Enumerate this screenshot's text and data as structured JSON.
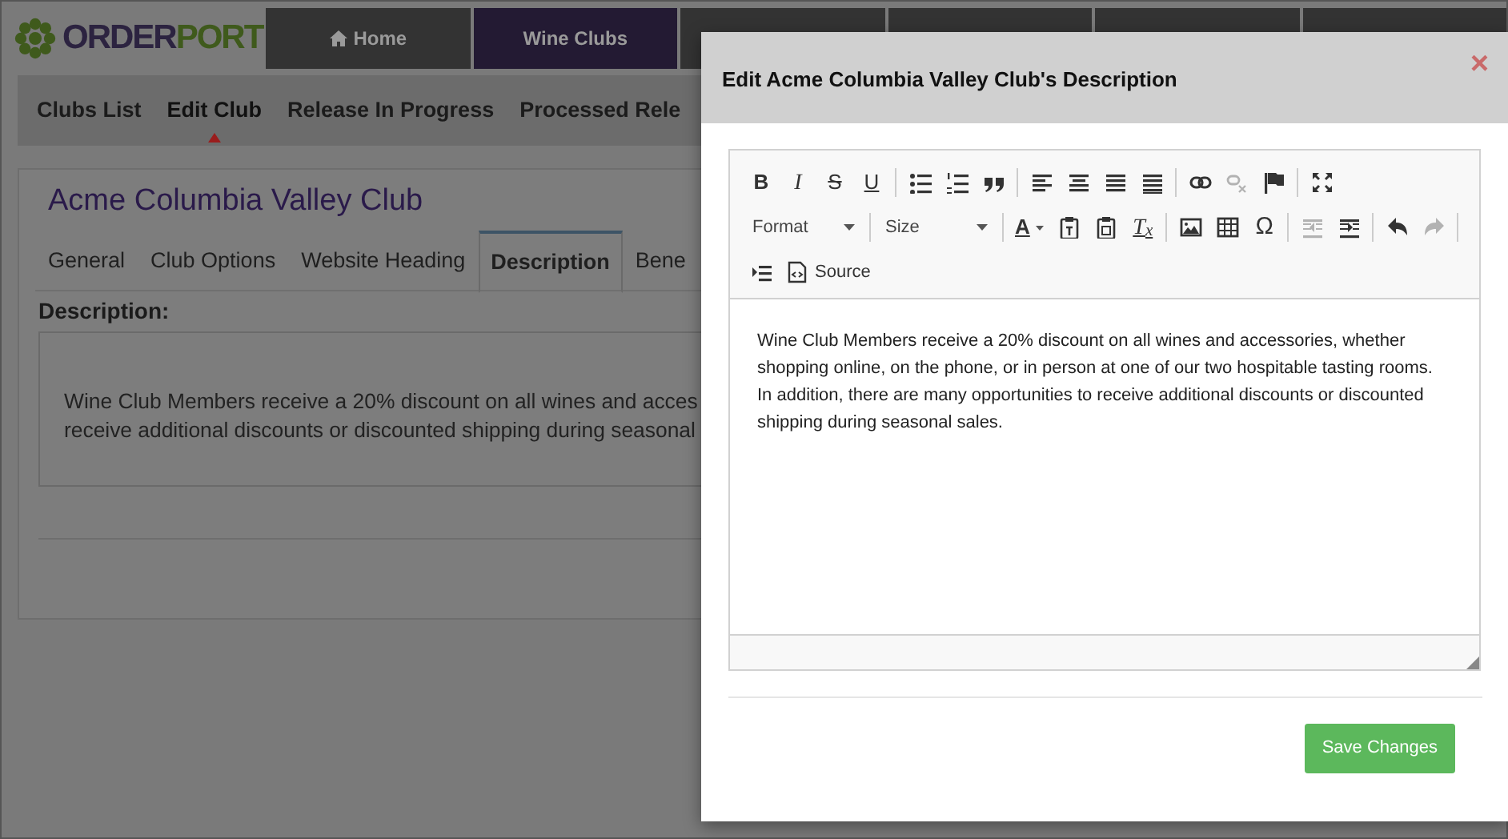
{
  "logo": {
    "first": "ORDER",
    "second": "PORT"
  },
  "top_nav": [
    {
      "kind": "icon_label",
      "label": "Home",
      "selected": false
    },
    {
      "kind": "label",
      "label": "Wine Clubs",
      "selected": true
    },
    {
      "kind": "blank",
      "selected": false
    },
    {
      "kind": "blank",
      "selected": false
    },
    {
      "kind": "blank",
      "selected": false
    },
    {
      "kind": "blank",
      "selected": false
    }
  ],
  "sub_nav": [
    {
      "label": "Clubs List",
      "selected": false
    },
    {
      "label": "Edit Club",
      "selected": true
    },
    {
      "label": "Release In Progress",
      "selected": false
    },
    {
      "label": "Processed Rele",
      "selected": false
    }
  ],
  "club_title": "Acme Columbia Valley Club",
  "tabs": [
    {
      "label": "General",
      "selected": false
    },
    {
      "label": "Club Options",
      "selected": false
    },
    {
      "label": "Website Heading",
      "selected": false
    },
    {
      "label": "Description",
      "selected": true
    },
    {
      "label": "Bene",
      "selected": false
    }
  ],
  "description_label": "Description:",
  "description_lines": [
    "Wine Club Members receive a 20% discount on all wines and acces",
    "receive additional discounts or discounted shipping during seasonal"
  ],
  "modal": {
    "title": "Edit Acme Columbia Valley Club's Description",
    "close_label": "×",
    "toolbar_rows": [
      [
        {
          "kind": "bold",
          "label": "B"
        },
        {
          "kind": "italic",
          "label": "I"
        },
        {
          "kind": "strike",
          "label": "S"
        },
        {
          "kind": "underline",
          "label": "U"
        },
        {
          "kind": "separator"
        },
        {
          "kind": "icon",
          "disabled": false
        },
        {
          "kind": "icon",
          "disabled": false
        },
        {
          "kind": "icon",
          "disabled": false
        },
        {
          "kind": "separator"
        },
        {
          "kind": "icon",
          "disabled": false
        },
        {
          "kind": "icon",
          "disabled": false
        },
        {
          "kind": "icon",
          "disabled": false
        },
        {
          "kind": "icon",
          "disabled": false
        },
        {
          "kind": "separator"
        },
        {
          "kind": "icon",
          "disabled": false
        },
        {
          "kind": "icon",
          "disabled": true
        },
        {
          "kind": "icon",
          "disabled": false
        },
        {
          "kind": "separator"
        },
        {
          "kind": "icon",
          "disabled": false
        }
      ],
      [
        {
          "kind": "dropdown",
          "label": "Format"
        },
        {
          "kind": "separator"
        },
        {
          "kind": "dropdown",
          "label": "Size"
        },
        {
          "kind": "separator"
        },
        {
          "kind": "color",
          "label": "A"
        },
        {
          "kind": "icon",
          "disabled": false
        },
        {
          "kind": "icon",
          "disabled": false
        },
        {
          "kind": "clear",
          "label": "T$_{x}$"
        },
        {
          "kind": "separator"
        },
        {
          "kind": "icon",
          "disabled": false
        },
        {
          "kind": "icon",
          "disabled": false
        },
        {
          "kind": "glyph",
          "label": "Ω"
        },
        {
          "kind": "separator"
        },
        {
          "kind": "icon",
          "disabled": true
        },
        {
          "kind": "icon",
          "disabled": false
        },
        {
          "kind": "separator"
        },
        {
          "kind": "icon",
          "disabled": false
        },
        {
          "kind": "icon",
          "disabled": true
        },
        {
          "kind": "separator"
        }
      ],
      [
        {
          "kind": "icon",
          "disabled": false
        },
        {
          "kind": "icon_text",
          "label": "Source"
        }
      ]
    ],
    "content": "Wine Club Members receive a 20% discount on all wines and accessories, whether shopping online, on the phone, or in person at one of our two hospitable tasting rooms. In addition, there are many opportunities to receive additional discounts or discounted shipping during seasonal sales.",
    "save_label": "Save Changes"
  }
}
